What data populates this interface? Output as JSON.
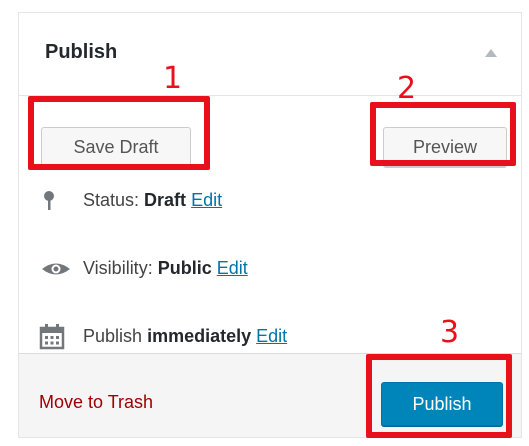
{
  "box": {
    "title": "Publish",
    "save_draft_label": "Save Draft",
    "preview_label": "Preview",
    "status": {
      "prefix": "Status:",
      "value": "Draft",
      "edit": "Edit"
    },
    "visibility": {
      "prefix": "Visibility:",
      "value": "Public",
      "edit": "Edit"
    },
    "schedule": {
      "prefix": "Publish",
      "value": "immediately",
      "edit": "Edit"
    },
    "trash_label": "Move to Trash",
    "publish_label": "Publish"
  },
  "annotations": {
    "one": "1",
    "two": "2",
    "three": "3"
  },
  "icons": {
    "toggle": "arrow-up-icon",
    "status": "pin-icon",
    "visibility": "eye-icon",
    "schedule": "calendar-icon"
  },
  "colors": {
    "highlight": "#e8101a",
    "link": "#0073aa",
    "primary": "#0085ba",
    "trash": "#a00000"
  }
}
